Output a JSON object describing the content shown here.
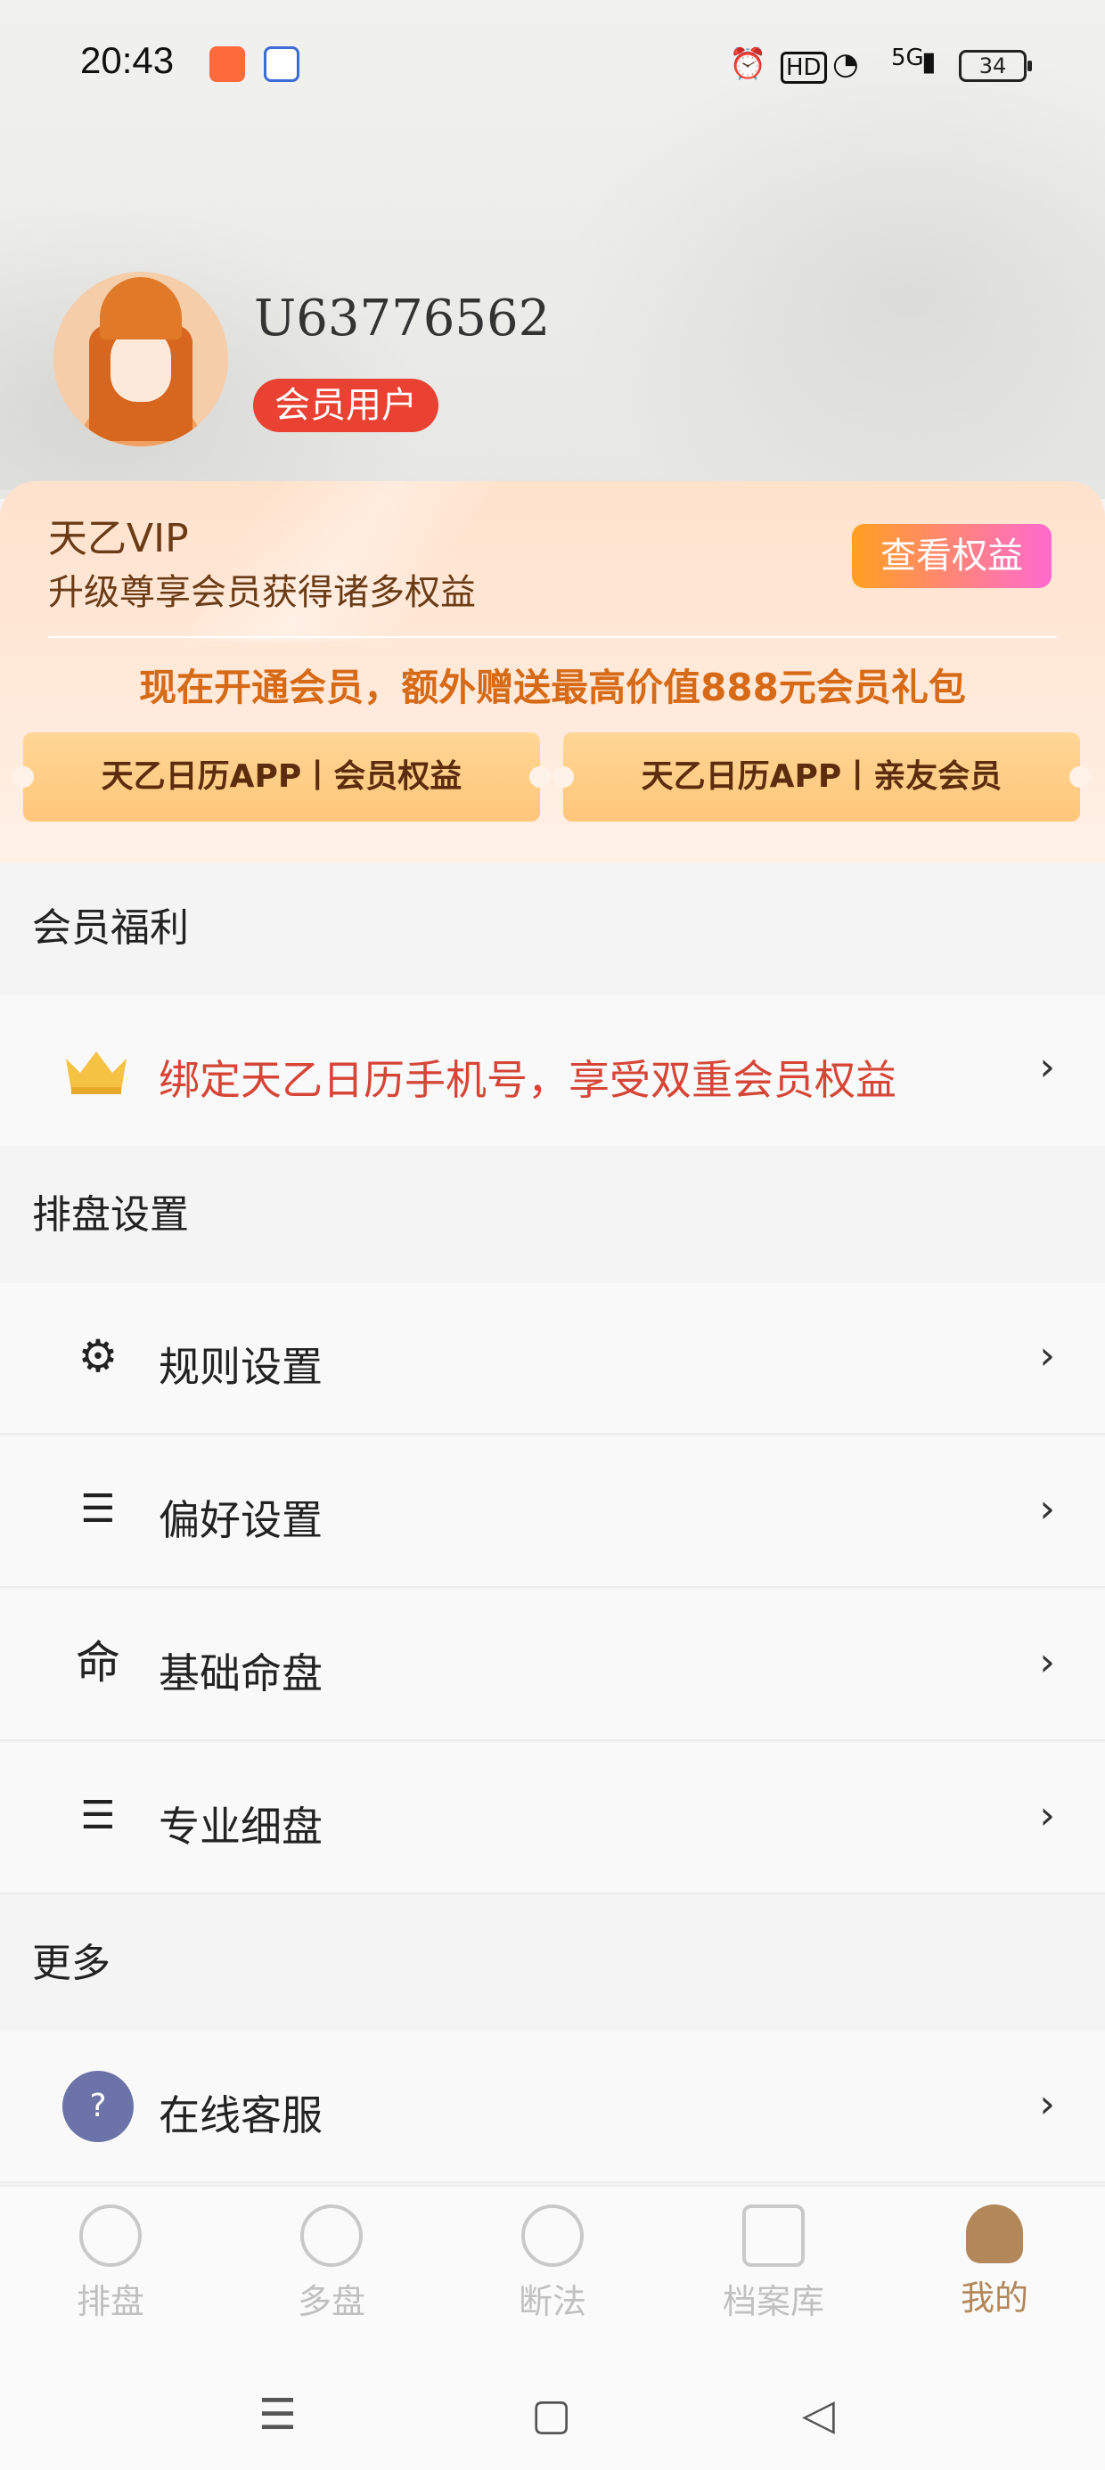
{
  "status_bar": {
    "time": "20:43",
    "network": "5G",
    "battery": "34",
    "icons": [
      "alarm-icon",
      "hd-icon",
      "wifi-icon",
      "signal-icon",
      "battery-icon"
    ]
  },
  "profile": {
    "username": "U63776562",
    "badge": "会员用户"
  },
  "vip": {
    "title": "天乙VIP",
    "subtitle": "升级尊享会员获得诸多权益",
    "button": "查看权益",
    "promo": "现在开通会员，额外赠送最高价值888元会员礼包",
    "tickets": [
      "天乙日历APP丨会员权益",
      "天乙日历APP丨亲友会员"
    ]
  },
  "sections": {
    "benefits": {
      "title": "会员福利",
      "item": "绑定天乙日历手机号，享受双重会员权益"
    },
    "settings": {
      "title": "排盘设置",
      "items": [
        "规则设置",
        "偏好设置",
        "基础命盘",
        "专业细盘"
      ],
      "icons": [
        "gear-list-icon",
        "sliders-icon",
        "ming-char-icon",
        "list-icon"
      ]
    },
    "more": {
      "title": "更多",
      "items": [
        "在线客服"
      ]
    }
  },
  "basic_icon_char": "命",
  "tabs": [
    {
      "label": "排盘",
      "icon": "paipan-icon",
      "active": false
    },
    {
      "label": "多盘",
      "icon": "duopan-icon",
      "active": false
    },
    {
      "label": "断法",
      "icon": "yinyang-icon",
      "active": false
    },
    {
      "label": "档案库",
      "icon": "archive-icon",
      "active": false
    },
    {
      "label": "我的",
      "icon": "profile-icon",
      "active": true
    }
  ],
  "colors": {
    "accent": "#e94132",
    "tab_active": "#b2875a",
    "promo": "#d76a16"
  }
}
